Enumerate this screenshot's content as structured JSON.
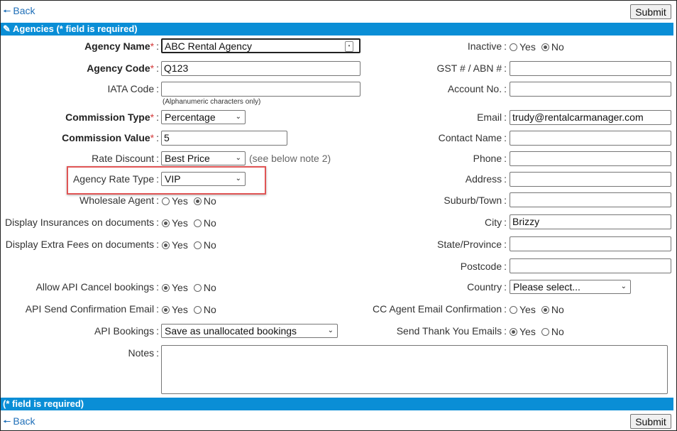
{
  "nav": {
    "back_label": "Back",
    "submit_label": "Submit"
  },
  "header_bar": {
    "title": "Agencies (* field is required)"
  },
  "footer_bar": {
    "title": "(* field is required)"
  },
  "left": {
    "agency_name": {
      "label": "Agency Name",
      "value": "ABC Rental Agency"
    },
    "agency_code": {
      "label": "Agency Code",
      "value": "Q123"
    },
    "iata_code": {
      "label": "IATA Code",
      "value": "",
      "note": "(Alphanumeric characters only)"
    },
    "commission_type": {
      "label": "Commission Type",
      "value": "Percentage"
    },
    "commission_value": {
      "label": "Commission Value",
      "value": "5"
    },
    "rate_discount": {
      "label": "Rate Discount",
      "value": "Best Price",
      "note": "(see below note 2)"
    },
    "agency_rate_type": {
      "label": "Agency Rate Type",
      "value": "VIP"
    },
    "wholesale_agent": {
      "label": "Wholesale Agent",
      "selected": "No"
    },
    "display_insurances": {
      "label": "Display Insurances on documents",
      "selected": "Yes"
    },
    "display_extra_fees": {
      "label": "Display Extra Fees on documents",
      "selected": "Yes"
    },
    "allow_api_cancel": {
      "label": "Allow API Cancel bookings",
      "selected": "Yes"
    },
    "api_send_confirmation": {
      "label": "API Send Confirmation Email",
      "selected": "Yes"
    },
    "api_bookings": {
      "label": "API Bookings",
      "value": "Save as unallocated bookings"
    },
    "notes": {
      "label": "Notes",
      "value": ""
    }
  },
  "right": {
    "inactive": {
      "label": "Inactive",
      "selected": "No"
    },
    "gst_abn": {
      "label": "GST # / ABN #",
      "value": ""
    },
    "account_no": {
      "label": "Account No.",
      "value": ""
    },
    "email": {
      "label": "Email",
      "value": "trudy@rentalcarmanager.com"
    },
    "contact_name": {
      "label": "Contact Name",
      "value": ""
    },
    "phone": {
      "label": "Phone",
      "value": ""
    },
    "address": {
      "label": "Address",
      "value": ""
    },
    "suburb": {
      "label": "Suburb/Town",
      "value": ""
    },
    "city": {
      "label": "City",
      "value": "Brizzy"
    },
    "state": {
      "label": "State/Province",
      "value": ""
    },
    "postcode": {
      "label": "Postcode",
      "value": ""
    },
    "country": {
      "label": "Country",
      "value": "Please select..."
    },
    "cc_agent_email": {
      "label": "CC Agent Email Confirmation",
      "selected": "No"
    },
    "send_thank_you": {
      "label": "Send Thank You Emails",
      "selected": "Yes"
    }
  },
  "options": {
    "yes": "Yes",
    "no": "No"
  },
  "colors": {
    "bar": "#0a8ed6",
    "required": "#d43a3a",
    "highlight": "#e05555",
    "link": "#1f6fb8"
  },
  "icons": {
    "back": "arrow-left-icon",
    "pencil": "pencil-icon",
    "password_manager": "key-fill-icon"
  }
}
